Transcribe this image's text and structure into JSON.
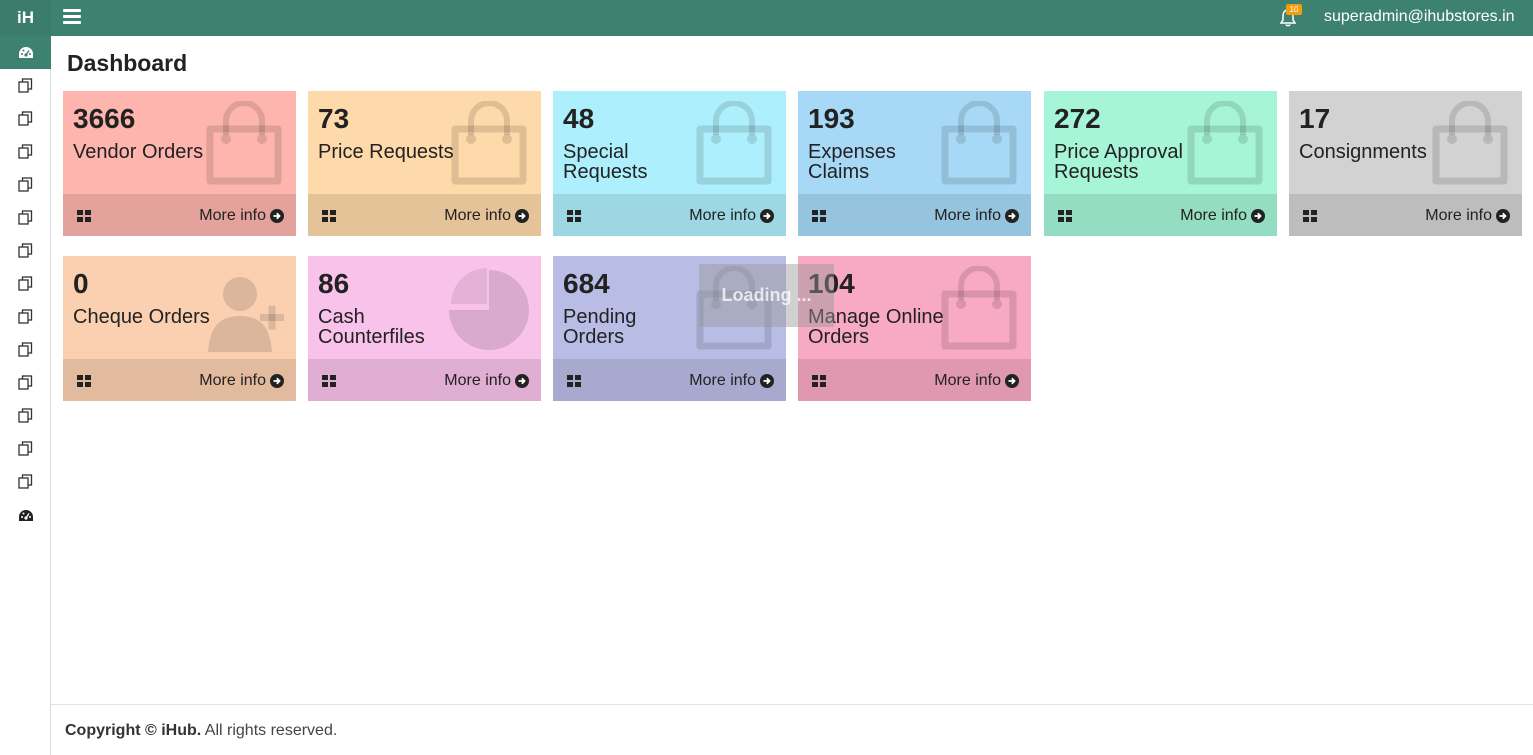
{
  "app": {
    "logo_text": "iH",
    "user_email": "superadmin@ihubstores.in",
    "notification_count": "10",
    "accent_color": "#3d8271"
  },
  "page": {
    "title": "Dashboard"
  },
  "cards": [
    {
      "count": "3666",
      "label": "Vendor Orders",
      "more": "More info",
      "color": "#fdb5ad",
      "footer_color": "#e3a39c",
      "icon": "shopping-bag-icon"
    },
    {
      "count": "73",
      "label": "Price Requests",
      "more": "More info",
      "color": "#fed9a9",
      "footer_color": "#e5c398",
      "icon": "shopping-bag-icon"
    },
    {
      "count": "48",
      "label": "Special Requests",
      "more": "More info",
      "color": "#adeffc",
      "footer_color": "#9cd7e3",
      "icon": "shopping-bag-icon"
    },
    {
      "count": "193",
      "label": "Expenses Claims",
      "more": "More info",
      "color": "#a7d9f6",
      "footer_color": "#96c3dd",
      "icon": "shopping-bag-icon"
    },
    {
      "count": "272",
      "label": "Price Approval Requests",
      "more": "More info",
      "color": "#a6f5d8",
      "footer_color": "#95ddc2",
      "icon": "shopping-bag-icon"
    },
    {
      "count": "17",
      "label": "Consignments",
      "more": "More info",
      "color": "#d2d2d2",
      "footer_color": "#bdbdbd",
      "icon": "shopping-bag-icon"
    },
    {
      "count": "0",
      "label": "Cheque Orders",
      "more": "More info",
      "color": "#fbd0b0",
      "footer_color": "#e2bb9e",
      "icon": "user-add-icon"
    },
    {
      "count": "86",
      "label": "Cash Counterfiles",
      "more": "More info",
      "color": "#f9c2ea",
      "footer_color": "#e0aed3",
      "icon": "pie-chart-icon"
    },
    {
      "count": "684",
      "label": "Pending Orders",
      "more": "More info",
      "color": "#b9bde5",
      "footer_color": "#a7aace",
      "icon": "shopping-bag-icon"
    },
    {
      "count": "104",
      "label": "Manage Online Orders",
      "more": "More info",
      "color": "#f8a9c4",
      "footer_color": "#df98b0",
      "icon": "shopping-bag-icon"
    }
  ],
  "loading_text": "Loading ...",
  "footer": {
    "copyright_prefix": "Copyright © ",
    "brand": "iHub.",
    "suffix": " All rights reserved."
  }
}
